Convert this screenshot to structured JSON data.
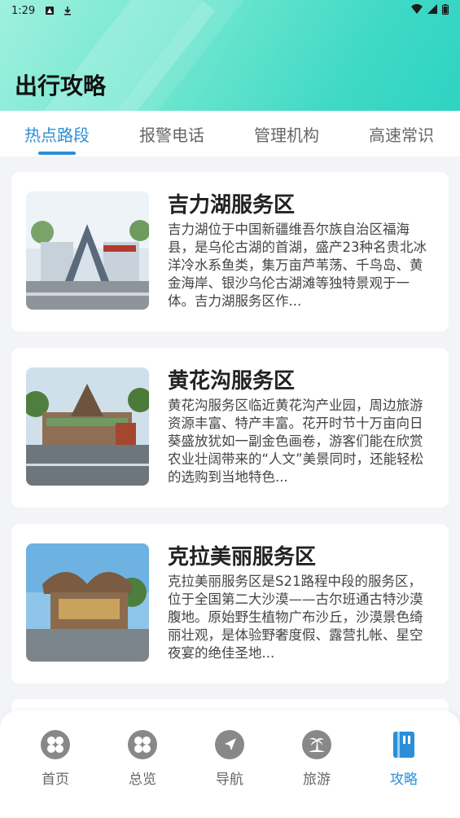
{
  "status_bar": {
    "time": "1:29"
  },
  "page_title": "出行攻略",
  "tabs": [
    {
      "label": "热点路段",
      "active": true
    },
    {
      "label": "报警电话",
      "active": false
    },
    {
      "label": "管理机构",
      "active": false
    },
    {
      "label": "高速常识",
      "active": false
    }
  ],
  "cards": [
    {
      "title": "吉力湖服务区",
      "description": "吉力湖位于中国新疆维吾尔族自治区福海县，是乌伦古湖的首湖，盛产23种名贵北冰洋冷水系鱼类，集万亩芦苇荡、千鸟岛、黄金海岸、银沙乌伦古湖滩等独特景观于一体。吉力湖服务区作..."
    },
    {
      "title": "黄花沟服务区",
      "description": "黄花沟服务区临近黄花沟产业园，周边旅游资源丰富、特产丰富。花开时节十万亩向日葵盛放犹如一副金色画卷，游客们能在欣赏农业壮阔带来的“人文”美景同时，还能轻松的选购到当地特色..."
    },
    {
      "title": "克拉美丽服务区",
      "description": "克拉美丽服务区是S21路程中段的服务区，位于全国第二大沙漠——古尔班通古特沙漠腹地。原始野生植物广布沙丘，沙漠景色绮丽壮观，是体验野奢度假、露营扎帐、星空夜宴的绝佳圣地..."
    }
  ],
  "bottom_nav": [
    {
      "label": "首页",
      "icon": "grid-icon",
      "active": false
    },
    {
      "label": "总览",
      "icon": "grid-icon",
      "active": false
    },
    {
      "label": "导航",
      "icon": "navigation-arrow-icon",
      "active": false
    },
    {
      "label": "旅游",
      "icon": "island-icon",
      "active": false
    },
    {
      "label": "攻略",
      "icon": "guide-book-icon",
      "active": true
    }
  ],
  "colors": {
    "accent": "#2a8fd6",
    "header_gradient_start": "#9ff0de",
    "header_gradient_end": "#2ed3c2"
  }
}
